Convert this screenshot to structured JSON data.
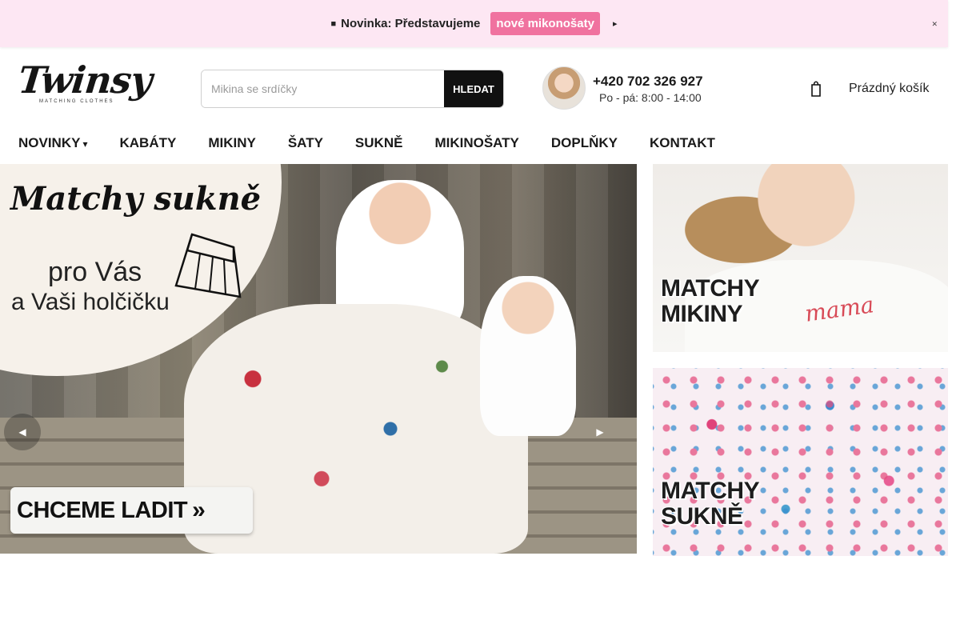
{
  "announcement": {
    "gift_icon": "gift-icon",
    "text": "Novinka: Představujeme",
    "link_label": "nové mikonošaty",
    "arrow_icon": "arrow-right-icon",
    "close_icon": "close-icon",
    "accent_color": "#f0729f",
    "background_color": "#fde7f3"
  },
  "header": {
    "logo_text": "Twinsy",
    "logo_tagline": "MATCHING CLOTHES",
    "search": {
      "placeholder": "Mikina se srdíčky",
      "value": "",
      "button_label": "HLEDAT"
    },
    "contact": {
      "phone": "+420 702 326 927",
      "hours": "Po - pá: 8:00 - 14:00"
    },
    "cart": {
      "icon": "cart-icon",
      "label": "Prázdný košík"
    }
  },
  "nav": {
    "items": [
      {
        "label": "NOVINKY",
        "has_dropdown": true
      },
      {
        "label": "KABÁTY"
      },
      {
        "label": "MIKINY"
      },
      {
        "label": "ŠATY"
      },
      {
        "label": "SUKNĚ"
      },
      {
        "label": "MIKINOŠATY"
      },
      {
        "label": "DOPLŇKY"
      },
      {
        "label": "KONTAKT"
      }
    ]
  },
  "hero": {
    "title": "Matchy sukně",
    "subtitle_line1": "pro Vás",
    "subtitle_line2": "a Vaši holčičku",
    "cta_label": "CHCEME LADIT",
    "prev_icon": "chevron-left-icon",
    "next_icon": "chevron-right-icon"
  },
  "side_banners": [
    {
      "line1": "MATCHY",
      "line2": "MIKINY",
      "print_text": "mama"
    },
    {
      "line1": "MATCHY",
      "line2": "SUKNĚ"
    }
  ]
}
